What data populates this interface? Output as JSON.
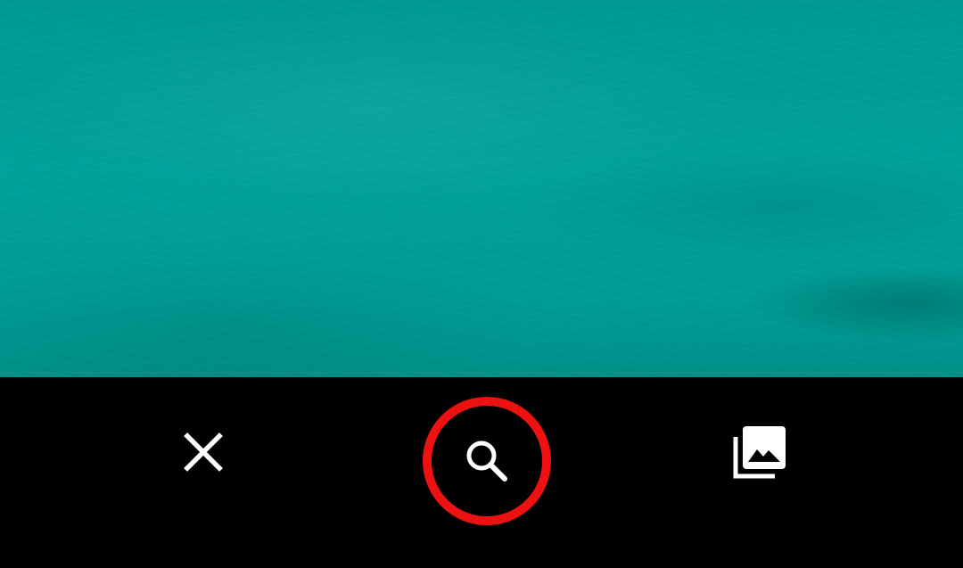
{
  "viewfinder": {
    "icon": "camera-viewfinder",
    "color": "#00a29b"
  },
  "bottom_bar": {
    "background": "#000000",
    "close": {
      "icon": "close-icon",
      "color": "#ffffff"
    },
    "search": {
      "icon": "search-icon",
      "color": "#ffffff",
      "highlight_color": "#ee1111"
    },
    "gallery": {
      "icon": "photo-library-icon",
      "color": "#ffffff"
    }
  }
}
